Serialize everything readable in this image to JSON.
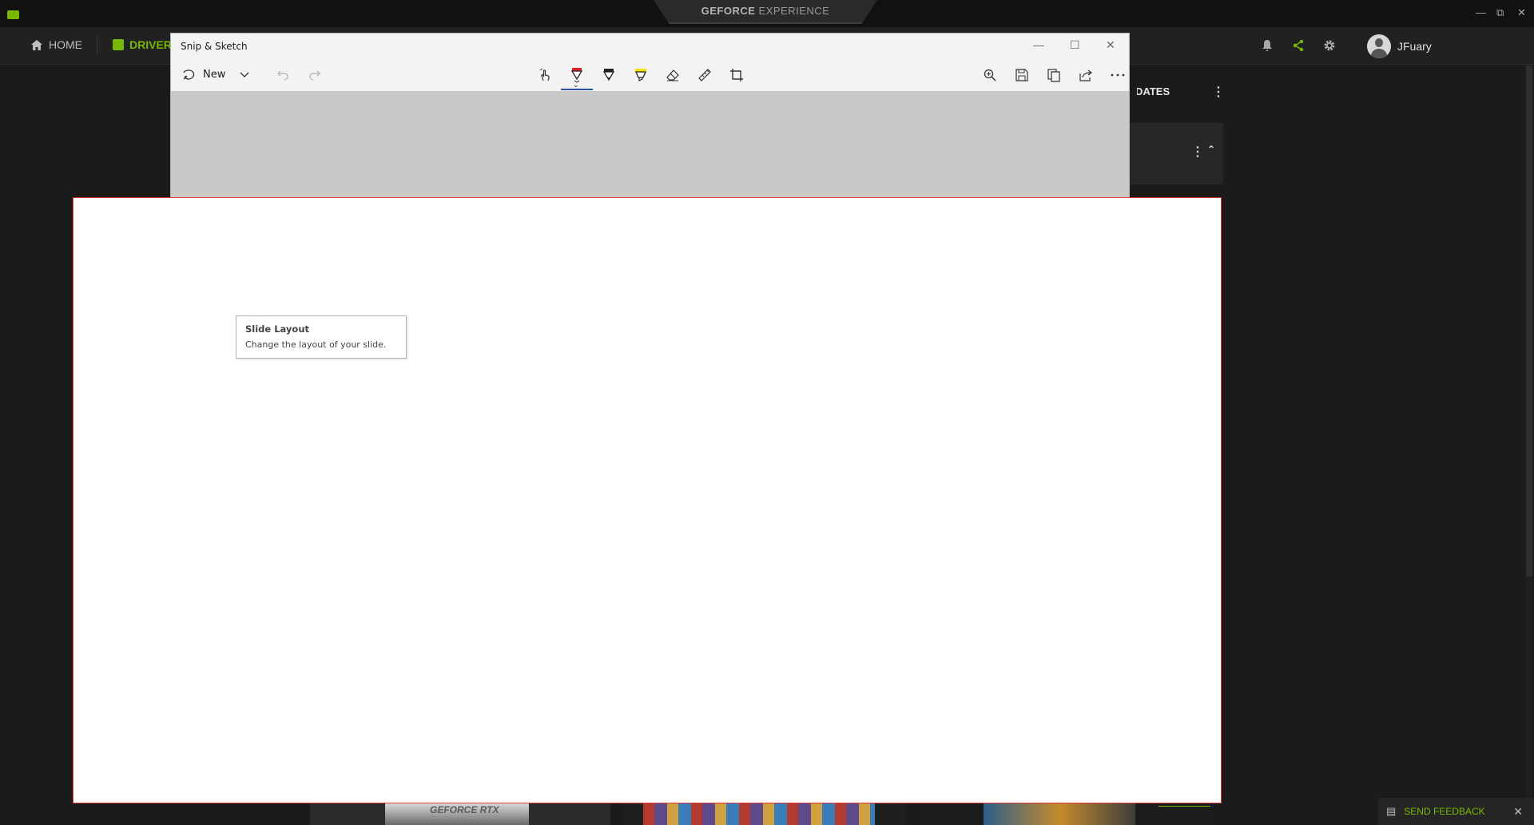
{
  "gfe": {
    "title_bold": "GEFORCE",
    "title_light": "EXPERIENCE",
    "nav": {
      "home_label": "HOME",
      "drivers_label": "DRIVERS"
    },
    "user_name": "JFuary",
    "updates_label": "UPDATES",
    "thumb_label": "GEFORCE RTX",
    "feedback_label": "SEND FEEDBACK",
    "accent_color": "#76b900",
    "icons": [
      "nvidia-logo-icon",
      "home-icon",
      "drivers-icon",
      "bell-icon",
      "share-icon",
      "gear-icon",
      "kebab-menu-icon",
      "chevron-up-icon",
      "feedback-icon",
      "close-icon"
    ]
  },
  "snip": {
    "title": "Snip & Sketch",
    "toolbar": {
      "new_label": "New",
      "tools": [
        "touch-writing-icon",
        "ballpoint-pen-icon",
        "pencil-icon",
        "highlighter-icon",
        "eraser-icon",
        "ruler-icon",
        "crop-icon"
      ],
      "actions": [
        "zoom-icon",
        "save-icon",
        "copy-icon",
        "share-icon",
        "more-icon"
      ],
      "active_tool": "ballpoint-pen-icon"
    }
  },
  "tooltip": {
    "title": "Slide Layout",
    "description": "Change the layout of your slide."
  }
}
